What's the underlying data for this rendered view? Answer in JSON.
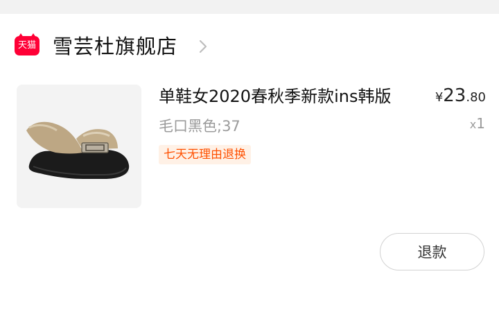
{
  "shop": {
    "badge_label": "天猫",
    "name": "雪芸杜旗舰店",
    "chevron_icon": "chevron-right-icon",
    "badge_color": "#ff0036"
  },
  "product": {
    "image_icon": "shoe-product-image",
    "title": "单鞋女2020春秋季新款ins韩版",
    "sku": "毛口黑色;37",
    "service_tag": "七天无理由退换",
    "price": {
      "currency": "¥",
      "integer": "23",
      "decimal": ".80"
    },
    "quantity": {
      "prefix": "x",
      "value": "1"
    }
  },
  "actions": {
    "refund_label": "退款"
  },
  "colors": {
    "accent_orange": "#ff5000",
    "tag_background": "#fff1e6",
    "muted_text": "#9a9a9a"
  }
}
